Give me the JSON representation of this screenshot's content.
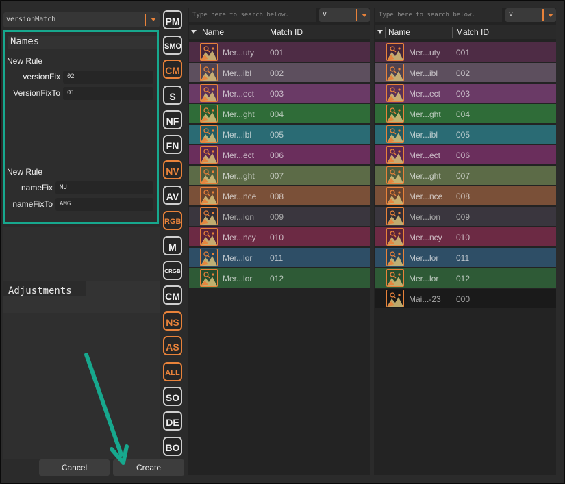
{
  "preset": {
    "value": "versionMatch"
  },
  "names_panel": {
    "title": "Names",
    "rules": [
      {
        "header": "New Rule",
        "fields": [
          {
            "label": "versionFix",
            "value": "02"
          },
          {
            "label": "VersionFixTo",
            "value": "01"
          }
        ]
      },
      {
        "header": "New Rule",
        "fields": [
          {
            "label": "nameFix",
            "value": "MU"
          },
          {
            "label": "nameFixTo",
            "value": "AMG"
          }
        ]
      }
    ]
  },
  "adjustments": {
    "title": "Adjustments"
  },
  "footer": {
    "cancel": "Cancel",
    "create": "Create"
  },
  "side_buttons": [
    {
      "label": "PM",
      "style": "normal"
    },
    {
      "label": "SMO",
      "style": "normal"
    },
    {
      "label": "CM",
      "style": "orange"
    },
    {
      "label": "S",
      "style": "normal"
    },
    {
      "label": "NF",
      "style": "normal"
    },
    {
      "label": "FN",
      "style": "normal"
    },
    {
      "label": "NV",
      "style": "orange"
    },
    {
      "label": "AV",
      "style": "normal"
    },
    {
      "label": "RGB",
      "style": "orange"
    },
    {
      "label": "M",
      "style": "normal"
    },
    {
      "label": "CRGB",
      "style": "normal"
    },
    {
      "label": "CM",
      "style": "normal"
    },
    {
      "label": "NS",
      "style": "orange"
    },
    {
      "label": "AS",
      "style": "orange"
    },
    {
      "label": "ALL",
      "style": "orange"
    },
    {
      "label": "SO",
      "style": "normal"
    },
    {
      "label": "DE",
      "style": "normal"
    },
    {
      "label": "BO",
      "style": "normal"
    }
  ],
  "left_list": {
    "search_placeholder": "Type here to search below.",
    "filter_value": "V",
    "columns": {
      "name": "Name",
      "match_id": "Match ID"
    },
    "rows": [
      {
        "name": "Mer...uty",
        "id": "001",
        "color": "#4e2c45"
      },
      {
        "name": "Mer...ibl",
        "id": "002",
        "color": "#5d4f5e"
      },
      {
        "name": "Mer...ect",
        "id": "003",
        "color": "#6a3a66"
      },
      {
        "name": "Mer...ght",
        "id": "004",
        "color": "#2f6c38"
      },
      {
        "name": "Mer...ibl",
        "id": "005",
        "color": "#2a6b74"
      },
      {
        "name": "Mer...ect",
        "id": "006",
        "color": "#6a2e5c"
      },
      {
        "name": "Mer...ght",
        "id": "007",
        "color": "#5c6b47"
      },
      {
        "name": "Mer...nce",
        "id": "008",
        "color": "#7a5038"
      },
      {
        "name": "Mer...ion",
        "id": "009",
        "color": "#3a363e"
      },
      {
        "name": "Mer...ncy",
        "id": "010",
        "color": "#6c2a44"
      },
      {
        "name": "Mer...lor",
        "id": "011",
        "color": "#2e4e66"
      },
      {
        "name": "Mer...lor",
        "id": "012",
        "color": "#2e5a36"
      }
    ]
  },
  "right_list": {
    "search_placeholder": "Type here to search below.",
    "filter_value": "V",
    "columns": {
      "name": "Name",
      "match_id": "Match ID"
    },
    "rows": [
      {
        "name": "Mer...uty",
        "id": "001",
        "color": "#4e2c45"
      },
      {
        "name": "Mer...ibl",
        "id": "002",
        "color": "#5d4f5e"
      },
      {
        "name": "Mer...ect",
        "id": "003",
        "color": "#6a3a66"
      },
      {
        "name": "Mer...ght",
        "id": "004",
        "color": "#2f6c38"
      },
      {
        "name": "Mer...ibl",
        "id": "005",
        "color": "#2a6b74"
      },
      {
        "name": "Mer...ect",
        "id": "006",
        "color": "#6a2e5c"
      },
      {
        "name": "Mer...ght",
        "id": "007",
        "color": "#5c6b47"
      },
      {
        "name": "Mer...nce",
        "id": "008",
        "color": "#7a5038"
      },
      {
        "name": "Mer...ion",
        "id": "009",
        "color": "#3a363e"
      },
      {
        "name": "Mer...ncy",
        "id": "010",
        "color": "#6c2a44"
      },
      {
        "name": "Mer...lor",
        "id": "011",
        "color": "#2e4e66"
      },
      {
        "name": "Mer...lor",
        "id": "012",
        "color": "#2e5a36"
      },
      {
        "name": "Mai...-23",
        "id": "000",
        "color": "#1a1a1a"
      }
    ]
  },
  "annotation": {
    "arrow_color": "#17a88e",
    "target": "create-button"
  },
  "colors": {
    "accent": "#e8823a",
    "highlight": "#17a88e"
  }
}
